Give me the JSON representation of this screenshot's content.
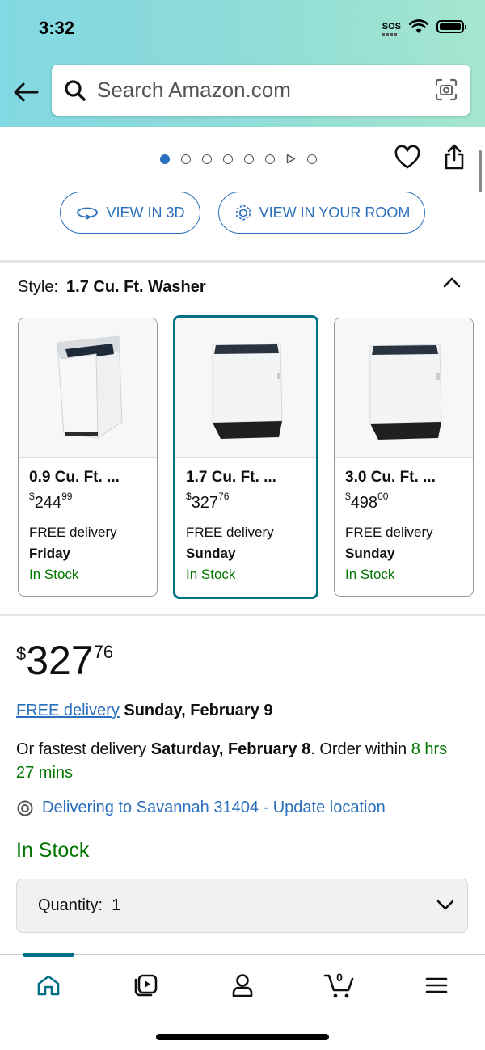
{
  "status_bar": {
    "time": "3:32",
    "sos": "SOS"
  },
  "search": {
    "placeholder": "Search Amazon.com"
  },
  "carousel": {
    "dot_count": 8,
    "active_index": 0
  },
  "view_buttons": {
    "view_3d": "VIEW IN 3D",
    "view_room": "VIEW IN YOUR ROOM"
  },
  "style": {
    "label": "Style:",
    "value": "1.7 Cu. Ft. Washer"
  },
  "options": [
    {
      "title": "0.9 Cu. Ft. ...",
      "currency": "$",
      "price_whole": "244",
      "price_cents": "99",
      "delivery": "FREE delivery",
      "day": "Friday",
      "stock": "In Stock"
    },
    {
      "title": "1.7 Cu. Ft. ...",
      "currency": "$",
      "price_whole": "327",
      "price_cents": "76",
      "delivery": "FREE delivery",
      "day": "Sunday",
      "stock": "In Stock"
    },
    {
      "title": "3.0 Cu. Ft. ...",
      "currency": "$",
      "price_whole": "498",
      "price_cents": "00",
      "delivery": "FREE delivery",
      "day": "Sunday",
      "stock": "In Stock"
    }
  ],
  "price": {
    "currency": "$",
    "whole": "327",
    "cents": "76"
  },
  "delivery": {
    "link": "FREE delivery",
    "date": "Sunday, February 9"
  },
  "fastest": {
    "prefix": "Or fastest delivery",
    "date": "Saturday, February 8",
    "mid": ". Order within",
    "time": "8 hrs 27 mins"
  },
  "location": {
    "text": "Delivering to Savannah 31404 - Update location"
  },
  "availability": "In Stock",
  "quantity": {
    "label": "Quantity:",
    "value": "1"
  },
  "cart": {
    "count": "0"
  },
  "colors": {
    "link": "#2a6fbd",
    "stock": "#007600",
    "teal": "#007185"
  }
}
